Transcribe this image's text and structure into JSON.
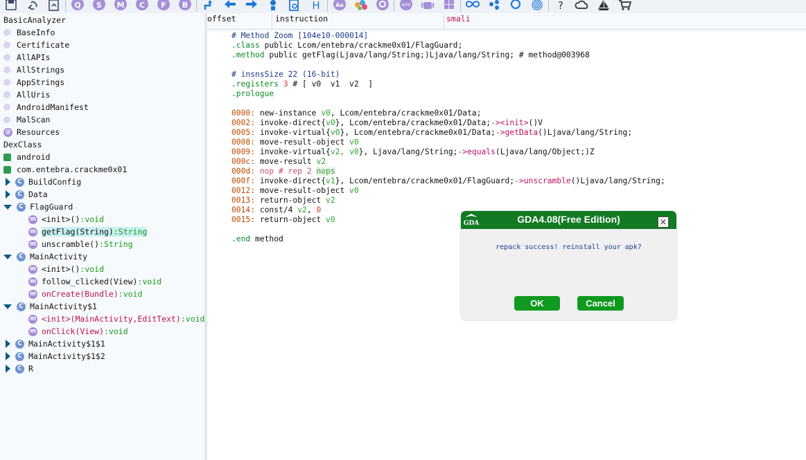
{
  "toolbar": {
    "icons": [
      "save-icon",
      "link-icon",
      "open-file-icon",
      "q-icon",
      "s-icon",
      "m-icon",
      "c-icon",
      "f-icon",
      "b-icon",
      "jump-icon",
      "back-arrow-icon",
      "forward-arrow-icon",
      "position-icon",
      "search-file-icon",
      "h-icon",
      "font-icon",
      "graph-icon",
      "settings-icon",
      "xml-icon",
      "android-icon",
      "windows-icon",
      "infinity-icon",
      "network-icon",
      "refresh-icon",
      "fingerprint-icon",
      "help-icon",
      "cloud-icon",
      "ship-icon",
      "cart-icon"
    ]
  },
  "tree": {
    "basic_analyzer": "BasicAnalyzer",
    "basic_items": [
      "BaseInfo",
      "Certificate",
      "AllAPIs",
      "AllStrings",
      "AppStrings",
      "AllUris",
      "AndroidManifest",
      "MalScan"
    ],
    "resources": "Resources",
    "dex_class": "DexClass",
    "pkg_android": "android",
    "pkg_main": "com.entebra.crackme0x01",
    "class_buildconfig": "BuildConfig",
    "class_data": "Data",
    "class_flagguard": "FlagGuard",
    "fg_init": "<init>()",
    "fg_init_ret": ":void",
    "fg_getflag": "getFlag(String)",
    "fg_getflag_ret": ":String",
    "fg_unscramble": "unscramble()",
    "fg_unscramble_ret": ":String",
    "class_mainactivity": "MainActivity",
    "ma_init": "<init>()",
    "ma_init_ret": ":void",
    "ma_follow": "follow_clicked(View)",
    "ma_follow_ret": ":void",
    "ma_oncreate": "onCreate(Bundle)",
    "ma_oncreate_ret": ":void",
    "class_ma1": "MainActivity$1",
    "ma1_init": "<init>(MainActivity,EditText)",
    "ma1_init_ret": ":void",
    "ma1_onclick": "onClick(View)",
    "ma1_onclick_ret": ":void",
    "class_ma11": "MainActivity$1$1",
    "class_ma12": "MainActivity$1$2",
    "class_r": "R"
  },
  "header": {
    "tab_offset": "offset",
    "tab_instruction": "instruction",
    "tab_smali": "smali"
  },
  "code": {
    "l1": "# Method Zoom [104e10-000014]",
    "l2_kw": ".class",
    "l2": " public Lcom/entebra/crackme0x01/FlagGuard;",
    "l3_kw": ".method",
    "l3": " public getFlag(Ljava/lang/String;)Ljava/lang/String; # method@003968",
    "l4": "# insnsSize 22 (16-bit)",
    "l5_kw": ".registers",
    "l5_num": " 3",
    "l5": " # [ v0  v1  v2  ]",
    "l6_kw": ".prologue",
    "i0_addr": "0000:",
    "i0_op": " new-instance ",
    "i0_reg": "v0",
    "i0_rest": ", Lcom/entebra/crackme0x01/Data;",
    "i1_addr": "0002:",
    "i1_op": " invoke-direct{",
    "i1_reg": "v0",
    "i1_mid": "}, Lcom/entebra/crackme0x01/Data;",
    "i1_arrow": "-><init>",
    "i1_tail": "()V",
    "i2_addr": "0005:",
    "i2_op": " invoke-virtual{",
    "i2_reg": "v0",
    "i2_mid": "}, Lcom/entebra/crackme0x01/Data;",
    "i2_arrow": "->getData",
    "i2_tail": "()Ljava/lang/String;",
    "i3_addr": "0008:",
    "i3_op": " move-result-object ",
    "i3_reg": "v0",
    "i4_addr": "0009:",
    "i4_op": " invoke-virtual{",
    "i4_reg": "v2, v0",
    "i4_mid": "}, Ljava/lang/String;",
    "i4_arrow": "->equals",
    "i4_tail": "(Ljava/lang/Object;)Z",
    "i5_addr": "000c:",
    "i5_op": " move-result ",
    "i5_reg": "v2",
    "i6_addr": "000d:",
    "i6_nop": " nop # rep 2 ",
    "i6_nops": "nops",
    "i7_addr": "000f:",
    "i7_op": " invoke-direct{",
    "i7_reg": "v1",
    "i7_mid": "}, Lcom/entebra/crackme0x01/FlagGuard;",
    "i7_arrow": "->unscramble",
    "i7_tail": "()Ljava/lang/String;",
    "i8_addr": "0012:",
    "i8_op": " move-result-object ",
    "i8_reg": "v0",
    "i9_addr": "0013:",
    "i9_op": " return-object ",
    "i9_reg": "v2",
    "i10_addr": "0014:",
    "i10_op": " const/4 ",
    "i10_reg": "v2",
    "i10_mid": ", ",
    "i10_num": "0",
    "i11_addr": "0015:",
    "i11_op": " return-object ",
    "i11_reg": "v0",
    "end_kw": ".end",
    "end": " method"
  },
  "dialog": {
    "title": "GDA4.08(Free Edition)",
    "logo_text": "GDA",
    "close_glyph": "×",
    "message": "repack success! reinstall your apk?",
    "ok_label": "OK",
    "cancel_label": "Cancel"
  }
}
